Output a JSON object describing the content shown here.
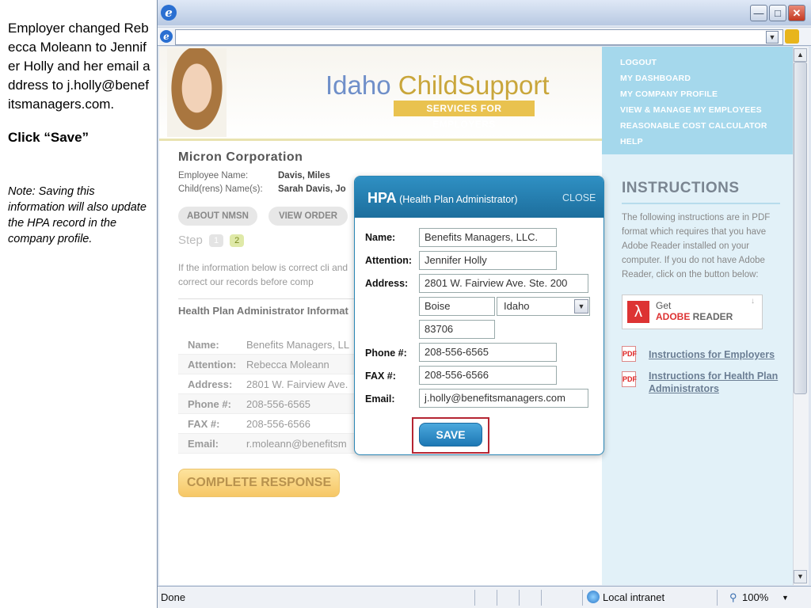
{
  "instructions": {
    "main": "Employer changed Rebecca Moleann to Jennifer Holly and her email address to j.holly@benefitsmanagers.com.",
    "click": "Click “Save”",
    "note": "Note: Saving this information will also update the HPA record in the company profile."
  },
  "browser": {
    "status": "Done",
    "zone": "Local intranet",
    "zoom": "100%",
    "window_buttons": [
      "minimize",
      "maximize",
      "close"
    ]
  },
  "banner": {
    "logo_part1": "Idaho ",
    "logo_part2": "ChildSupport",
    "logo_sub": "SERVICES FOR EMPLOYERS"
  },
  "nav": {
    "items": [
      "LOGOUT",
      "MY DASHBOARD",
      "MY COMPANY PROFILE",
      "VIEW & MANAGE MY EMPLOYEES",
      "REASONABLE COST CALCULATOR",
      "HELP"
    ]
  },
  "page": {
    "company": "Micron Corporation",
    "employee_label": "Employee Name:",
    "employee_value": "Davis, Miles",
    "children_label": "Child(rens) Name(s):",
    "children_value": "Sarah Davis, Jo",
    "btn_about": "ABOUT NMSN",
    "btn_view": "VIEW ORDER",
    "step_label": "Step",
    "step1": "1",
    "step2": "2",
    "para": "If the information below is correct cli and correct our records before comp",
    "hpa_heading": "Health Plan Administrator Informat",
    "hpa_rows": [
      {
        "label": "Name:",
        "value": "Benefits Managers, LL"
      },
      {
        "label": "Attention:",
        "value": "Rebecca Moleann"
      },
      {
        "label": "Address:",
        "value": "2801 W. Fairview Ave."
      },
      {
        "label": "Phone #:",
        "value": "208-556-6565"
      },
      {
        "label": "FAX #:",
        "value": "208-556-6566"
      },
      {
        "label": "Email:",
        "value": "r.moleann@benefitsm"
      }
    ],
    "complete_btn": "COMPLETE RESPONSE"
  },
  "sidebar": {
    "title": "INSTRUCTIONS",
    "text": "The following instructions are in PDF format which requires that you have Adobe Reader installed on your computer. If you do not have Adobe Reader, click on the button below:",
    "adobe_get": "Get",
    "adobe_brand": "ADOBE",
    "adobe_reader": " READER",
    "link_employers": "Instructions for Employers",
    "link_hpa": "Instructions for Health Plan Administrators"
  },
  "modal": {
    "title_abbr": "HPA",
    "title_full": " (Health Plan Administrator)",
    "close": "CLOSE",
    "labels": {
      "name": "Name:",
      "attention": "Attention:",
      "address": "Address:",
      "phone": "Phone #:",
      "fax": "FAX #:",
      "email": "Email:"
    },
    "values": {
      "name": "Benefits Managers, LLC.",
      "attention": "Jennifer Holly",
      "address": "2801 W. Fairview Ave.  Ste. 200",
      "city": "Boise",
      "state": "Idaho",
      "zip": "83706",
      "phone": "208-556-6565",
      "fax": "208-556-6566",
      "email": "j.holly@benefitsmanagers.com"
    },
    "save": "SAVE"
  },
  "colors": {
    "modal_header": "#2080b5",
    "nav_bg": "#a5d8ec",
    "highlight": "#b52532"
  }
}
